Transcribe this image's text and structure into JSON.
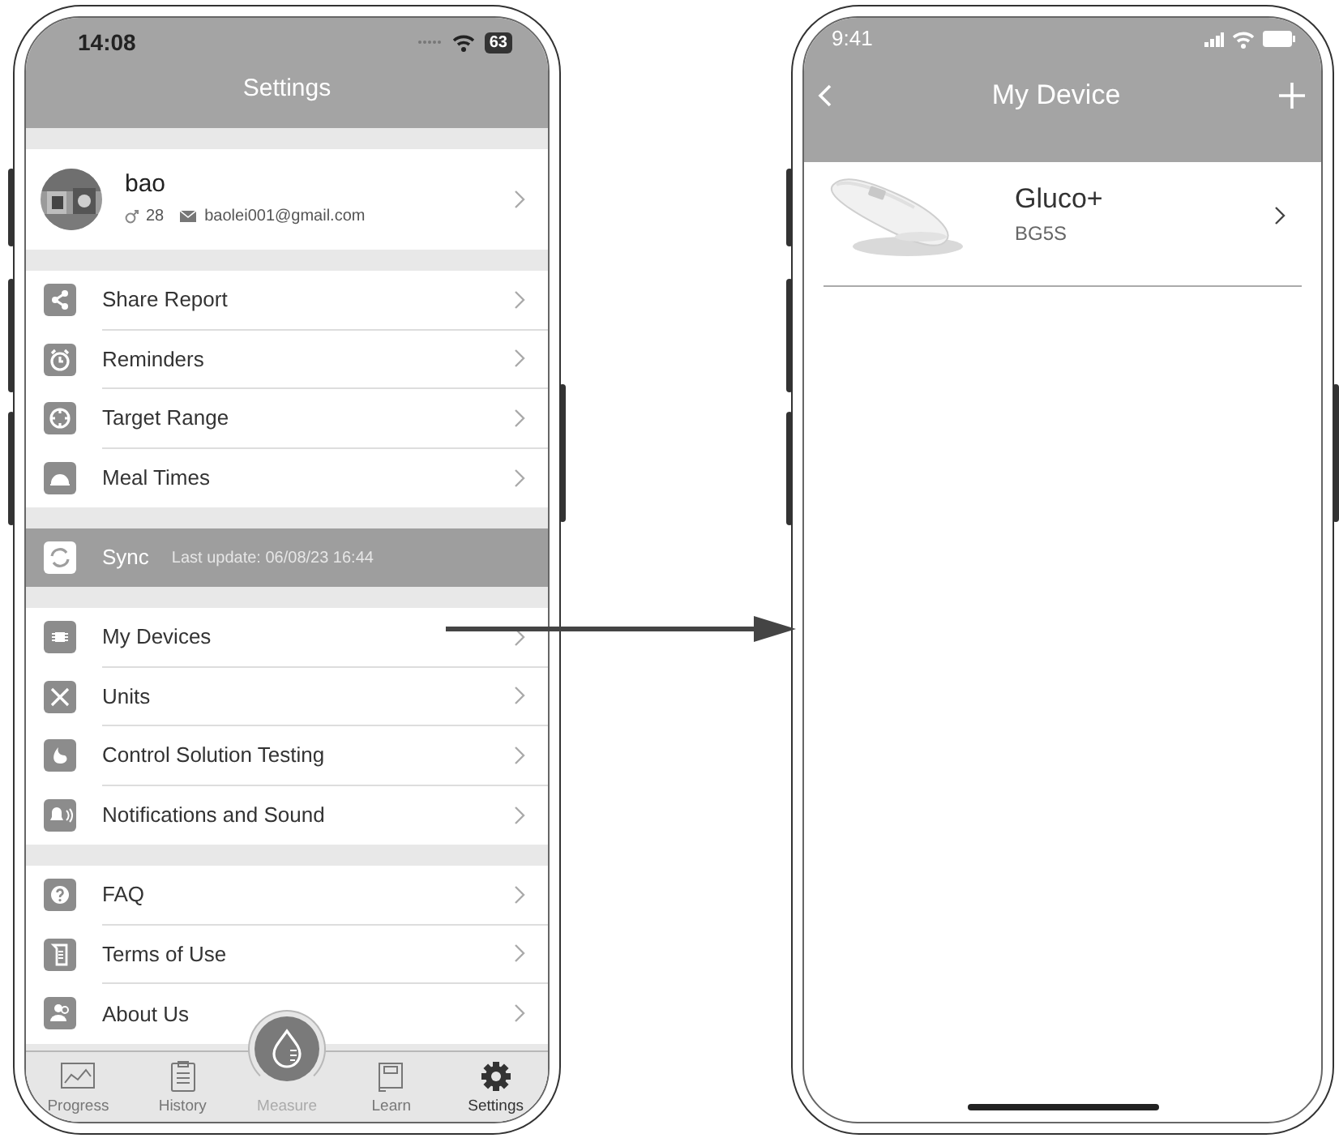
{
  "left_phone": {
    "status_bar": {
      "time": "14:08",
      "battery": "63"
    },
    "header": {
      "title": "Settings"
    },
    "profile": {
      "name": "bao",
      "age": "28",
      "email": "baolei001@gmail.com"
    },
    "groups": [
      {
        "kind": "list",
        "items": [
          {
            "label": "Share Report",
            "kind": "share"
          },
          {
            "label": "Reminders",
            "kind": "alarm"
          },
          {
            "label": "Target Range",
            "kind": "target"
          },
          {
            "label": "Meal Times",
            "kind": "meal"
          }
        ]
      },
      {
        "kind": "sync",
        "items": [
          {
            "label": "Sync",
            "detail": "Last update: 06/08/23 16:44",
            "kind": "sync"
          }
        ]
      },
      {
        "kind": "list",
        "items": [
          {
            "label": "My Devices",
            "kind": "chip"
          },
          {
            "label": "Units",
            "kind": "units"
          },
          {
            "label": "Control Solution Testing",
            "kind": "solution"
          },
          {
            "label": "Notifications and Sound",
            "kind": "bell"
          }
        ]
      },
      {
        "kind": "list",
        "items": [
          {
            "label": "FAQ",
            "kind": "faq"
          },
          {
            "label": "Terms of Use",
            "kind": "terms"
          },
          {
            "label": "About Us",
            "kind": "about"
          }
        ]
      }
    ],
    "tab_bar": [
      {
        "label": "Progress",
        "kind": "chart",
        "selected": false
      },
      {
        "label": "History",
        "kind": "clipboard",
        "selected": false
      },
      {
        "label": "Measure",
        "kind": "raised",
        "selected": false
      },
      {
        "label": "Learn",
        "kind": "book",
        "selected": false
      },
      {
        "label": "Settings",
        "kind": "gear",
        "selected": true
      }
    ]
  },
  "right_phone": {
    "status_bar": {
      "time": "9:41"
    },
    "header": {
      "title": "My Device"
    },
    "devices": [
      {
        "kind": "picture",
        "name": "Gluco+",
        "model": "BG5S"
      }
    ]
  }
}
